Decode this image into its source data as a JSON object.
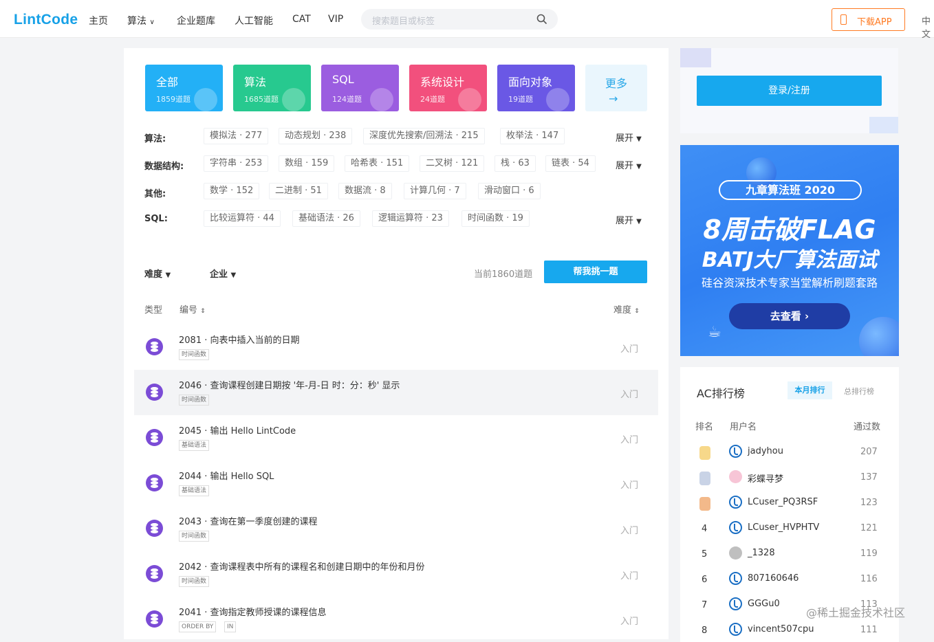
{
  "header": {
    "logo": "LintCode",
    "nav": [
      "主页",
      "算法",
      "企业题库",
      "人工智能",
      "CAT",
      "VIP"
    ],
    "search_placeholder": "搜索题目或标签",
    "app_button": "下载APP",
    "lang": "中文"
  },
  "categories": [
    {
      "name": "全部",
      "count": "1859道题",
      "color": "#23b0f6"
    },
    {
      "name": "算法",
      "count": "1685道题",
      "color": "#27c98f"
    },
    {
      "name": "SQL",
      "count": "124道题",
      "color": "#9b5de0"
    },
    {
      "name": "系统设计",
      "count": "24道题",
      "color": "#f2507d"
    },
    {
      "name": "面向对象",
      "count": "19道题",
      "color": "#6a58e5"
    }
  ],
  "more": {
    "label": "更多",
    "arrow": "→"
  },
  "filters": [
    {
      "label": "算法:",
      "tags": [
        "模拟法 · 277",
        "动态规划 · 238",
        "深度优先搜索/回溯法 · 215",
        "枚举法 · 147"
      ],
      "expand": "展开"
    },
    {
      "label": "数据结构:",
      "tags": [
        "字符串 · 253",
        "数组 · 159",
        "哈希表 · 151",
        "二叉树 · 121",
        "栈 · 63",
        "链表 · 54"
      ],
      "expand": "展开"
    },
    {
      "label": "其他:",
      "tags": [
        "数学 · 152",
        "二进制 · 51",
        "数据流 · 8",
        "计算几何 · 7",
        "滑动窗口 · 6"
      ],
      "expand": ""
    },
    {
      "label": "SQL:",
      "tags": [
        "比较运算符 · 44",
        "基础语法 · 26",
        "逻辑运算符 · 23",
        "时间函数 · 19"
      ],
      "expand": "展开"
    }
  ],
  "toolbar": {
    "difficulty": "难度",
    "company": "企业",
    "current_count": "当前1860道题",
    "pick_button": "帮我挑一题"
  },
  "table_header": {
    "type": "类型",
    "id": "编号",
    "difficulty": "难度"
  },
  "problems": [
    {
      "title": "2081 · 向表中插入当前的日期",
      "tags": [
        "时间函数"
      ],
      "difficulty": "入门"
    },
    {
      "title": "2046 · 查询课程创建日期按 '年-月-日 时：分：秒' 显示",
      "tags": [
        "时间函数"
      ],
      "difficulty": "入门"
    },
    {
      "title": "2045 · 输出 Hello LintCode",
      "tags": [
        "基础语法"
      ],
      "difficulty": "入门"
    },
    {
      "title": "2044 · 输出 Hello SQL",
      "tags": [
        "基础语法"
      ],
      "difficulty": "入门"
    },
    {
      "title": "2043 · 查询在第一季度创建的课程",
      "tags": [
        "时间函数"
      ],
      "difficulty": "入门"
    },
    {
      "title": "2042 · 查询课程表中所有的课程名和创建日期中的年份和月份",
      "tags": [
        "时间函数"
      ],
      "difficulty": "入门"
    },
    {
      "title": "2041 · 查询指定教师授课的课程信息",
      "tags": [
        "ORDER BY",
        "IN"
      ],
      "difficulty": "入门"
    }
  ],
  "login": {
    "button": "登录/注册"
  },
  "banner": {
    "pill": "九章算法班 2020",
    "line1": "8周击破FLAG",
    "line2": "BATJ大厂算法面试",
    "line3": "硅谷资深技术专家当堂解析刷题套路",
    "button": "去查看 ›"
  },
  "ranking": {
    "title": "AC排行榜",
    "tab_month": "本月排行",
    "tab_total": "总排行榜",
    "headers": {
      "rank": "排名",
      "user": "用户名",
      "passed": "通过数"
    },
    "rows": [
      {
        "rank": "",
        "medal": "gold",
        "user": "jadyhou",
        "passed": "207"
      },
      {
        "rank": "",
        "medal": "silver",
        "user": "彩蝶寻梦",
        "passed": "137"
      },
      {
        "rank": "",
        "medal": "bronze",
        "user": "LCuser_PQ3RSF",
        "passed": "123"
      },
      {
        "rank": "4",
        "medal": "",
        "user": "LCuser_HVPHTV",
        "passed": "121"
      },
      {
        "rank": "5",
        "medal": "",
        "user": "_1328",
        "passed": "119"
      },
      {
        "rank": "6",
        "medal": "",
        "user": "807160646",
        "passed": "116"
      },
      {
        "rank": "7",
        "medal": "",
        "user": "GGGu0",
        "passed": "113"
      },
      {
        "rank": "8",
        "medal": "",
        "user": "vincent507cpu",
        "passed": "111"
      }
    ]
  },
  "watermark": "@稀土掘金技术社区"
}
